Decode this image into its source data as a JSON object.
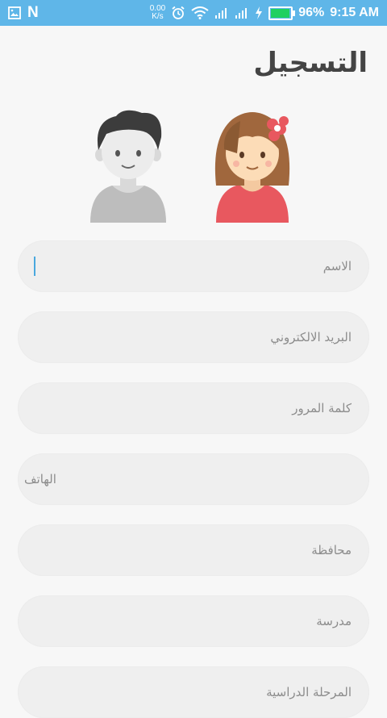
{
  "status_bar": {
    "left_letter": "N",
    "speed_value": "0.00",
    "speed_unit": "K/s",
    "battery": "96%",
    "battery_level": 0.96,
    "time": "9:15 AM",
    "bg_color": "#5fb6e8"
  },
  "page": {
    "title": "التسجيل"
  },
  "avatars": {
    "girl_icon": "girl-avatar",
    "boy_icon": "boy-avatar"
  },
  "form": {
    "name_placeholder": "الاسم",
    "email_placeholder": "البريد الالكتروني",
    "password_placeholder": "كلمة المرور",
    "phone_placeholder": "الهاتف",
    "governorate_placeholder": "محافظة",
    "school_placeholder": "مدرسة",
    "next_placeholder": "المرحلة الدراسية"
  }
}
